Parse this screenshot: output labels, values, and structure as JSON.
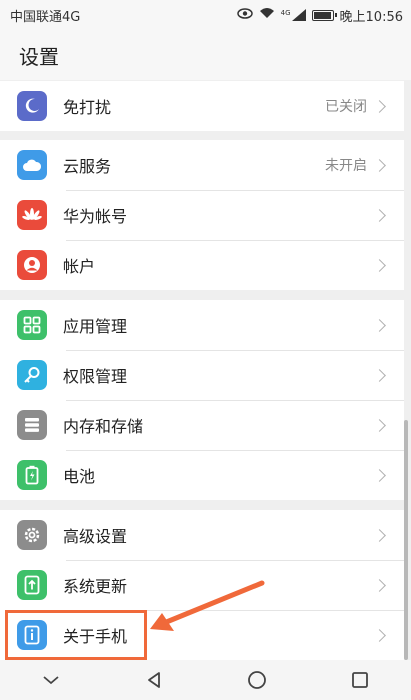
{
  "status_bar": {
    "carrier": "中国联通4G",
    "net_label": "4G",
    "time": "晚上10:56",
    "battery_level": 0.85
  },
  "header": {
    "title": "设置"
  },
  "groups": [
    {
      "items": [
        {
          "label": "免打扰",
          "value": "已关闭",
          "icon": "moon-icon",
          "color": "#5b6bc9"
        }
      ]
    },
    {
      "items": [
        {
          "label": "云服务",
          "value": "未开启",
          "icon": "cloud-icon",
          "color": "#3f9be8"
        },
        {
          "label": "华为帐号",
          "value": "",
          "icon": "huawei-icon",
          "color": "#ea4b3b"
        },
        {
          "label": "帐户",
          "value": "",
          "icon": "account-icon",
          "color": "#ea4b3b"
        }
      ]
    },
    {
      "items": [
        {
          "label": "应用管理",
          "value": "",
          "icon": "apps-grid-icon",
          "color": "#3ec06a"
        },
        {
          "label": "权限管理",
          "value": "",
          "icon": "key-icon",
          "color": "#2fb1e0"
        },
        {
          "label": "内存和存储",
          "value": "",
          "icon": "storage-icon",
          "color": "#8c8c8c"
        },
        {
          "label": "电池",
          "value": "",
          "icon": "battery-icon",
          "color": "#3ec06a"
        }
      ]
    },
    {
      "items": [
        {
          "label": "高级设置",
          "value": "",
          "icon": "gear-icon",
          "color": "#8c8c8c"
        },
        {
          "label": "系统更新",
          "value": "",
          "icon": "update-icon",
          "color": "#3ec06a"
        },
        {
          "label": "关于手机",
          "value": "",
          "icon": "about-phone-icon",
          "color": "#3f9be8"
        }
      ]
    }
  ],
  "annotation": {
    "highlight_color": "#f0693a"
  }
}
